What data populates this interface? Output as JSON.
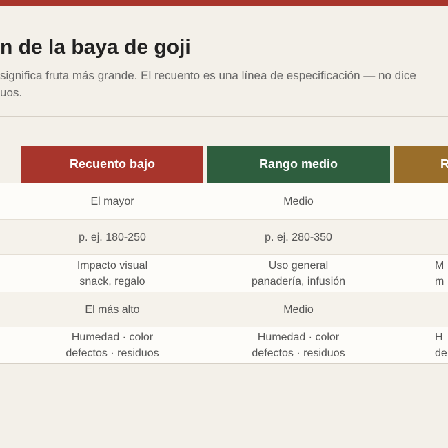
{
  "colors": {
    "top_strip": "#a8352c",
    "low_count": "#a8352c",
    "mid_range": "#2e5e3e",
    "high": "#9a6e2a"
  },
  "document": {
    "title": "n de la baya de goji",
    "subtitle": "significa fruta más grande. El recuento es una línea de especificación — no dice\nuos."
  },
  "table": {
    "headers": [
      {
        "label": "Recuento bajo",
        "color": "#a8352c"
      },
      {
        "label": "Rango medio",
        "color": "#2e5e3e"
      },
      {
        "label": "R",
        "color": "#9a6e2a"
      }
    ],
    "rows": [
      {
        "cells": [
          "El mayor",
          "Medio",
          ""
        ]
      },
      {
        "cells": [
          "p. ej. 180-250",
          "p. ej. 280-350",
          ""
        ]
      },
      {
        "cells": [
          "Impacto visual\nsnack, regalo",
          "Uso general\npanadería, infusión",
          "M\nm"
        ]
      },
      {
        "cells": [
          "El más alto",
          "Medio",
          ""
        ]
      },
      {
        "cells": [
          "Humedad · color\ndefectos · residuos",
          "Humedad · color\ndefectos · residuos",
          "H\nde"
        ]
      }
    ]
  }
}
